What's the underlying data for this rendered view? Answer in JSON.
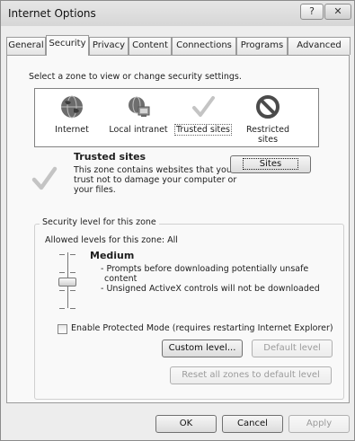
{
  "window": {
    "title": "Internet Options",
    "help_glyph": "?",
    "close_glyph": "✕"
  },
  "tabs": [
    {
      "label": "General"
    },
    {
      "label": "Security",
      "active": true
    },
    {
      "label": "Privacy"
    },
    {
      "label": "Content"
    },
    {
      "label": "Connections"
    },
    {
      "label": "Programs"
    },
    {
      "label": "Advanced"
    }
  ],
  "security": {
    "zone_prompt": "Select a zone to view or change security settings.",
    "zones": [
      {
        "label": "Internet",
        "icon": "globe-icon"
      },
      {
        "label": "Local intranet",
        "icon": "intranet-icon"
      },
      {
        "label": "Trusted sites",
        "icon": "checkmark-icon",
        "selected": true
      },
      {
        "label_line1": "Restricted",
        "label_line2": "sites",
        "icon": "restricted-icon"
      }
    ],
    "zone_info": {
      "title": "Trusted sites",
      "line1": "This zone contains websites that you",
      "line2": "trust not to damage your computer or",
      "line3": "your files.",
      "sites_button": "Sites"
    },
    "level_group": {
      "legend": "Security level for this zone",
      "allowed": "Allowed levels for this zone: All",
      "level_name": "Medium",
      "bullet1_line1": "- Prompts before downloading potentially unsafe",
      "bullet1_line2": "content",
      "bullet2": "- Unsigned ActiveX controls will not be downloaded",
      "slider_level": "Medium",
      "protected_mode": "Enable Protected Mode (requires restarting Internet Explorer)",
      "protected_mode_checked": false,
      "custom_level_button": "Custom level...",
      "default_level_button": "Default level"
    },
    "reset_all_button": "Reset all zones to default level"
  },
  "footer": {
    "ok": "OK",
    "cancel": "Cancel",
    "apply": "Apply"
  }
}
